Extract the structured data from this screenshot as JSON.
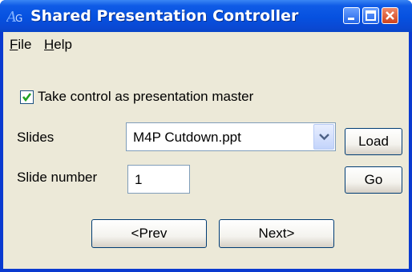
{
  "window": {
    "title": "Shared Presentation Controller",
    "app_icon": "ag-logo-icon",
    "controls": [
      "minimize-icon",
      "maximize-icon",
      "close-icon"
    ]
  },
  "menu": {
    "file_first": "F",
    "file_rest": "ile",
    "help_first": "H",
    "help_rest": "elp"
  },
  "master": {
    "checked": true,
    "label": "Take control as presentation master"
  },
  "slides": {
    "label": "Slides",
    "selected": "M4P Cutdown.ppt",
    "load_label": "Load"
  },
  "slide_number": {
    "label": "Slide number",
    "value": "1",
    "go_label": "Go"
  },
  "nav": {
    "prev_label": "<Prev",
    "next_label": "Next>"
  },
  "colors": {
    "titlebar": "#0651e0",
    "client": "#ece9d8",
    "check": "#21a121"
  }
}
